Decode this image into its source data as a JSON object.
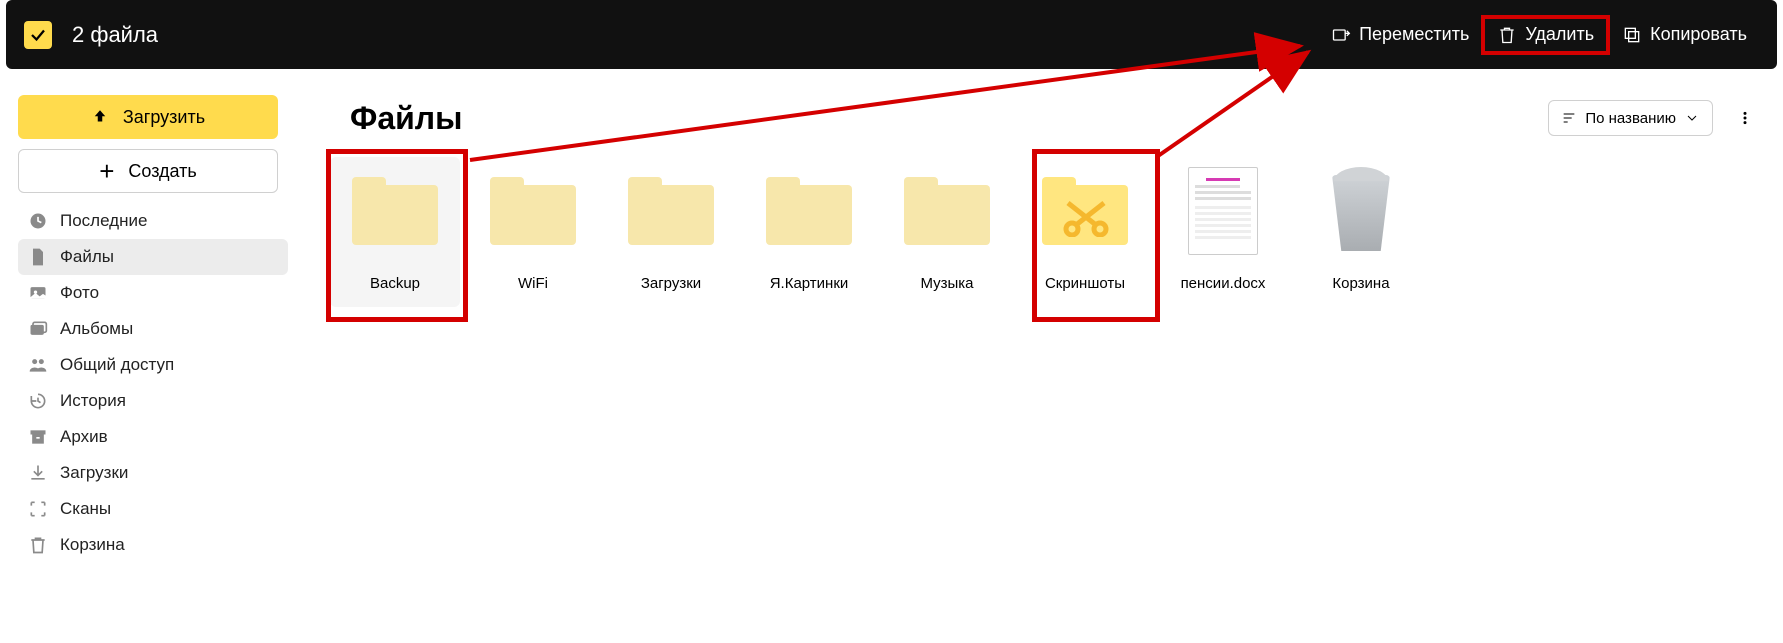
{
  "topbar": {
    "selection_label": "2 файла",
    "move_label": "Переместить",
    "delete_label": "Удалить",
    "copy_label": "Копировать"
  },
  "sidebar": {
    "upload_label": "Загрузить",
    "create_label": "Создать",
    "items": [
      {
        "id": "recent",
        "label": "Последние"
      },
      {
        "id": "files",
        "label": "Файлы"
      },
      {
        "id": "photo",
        "label": "Фото"
      },
      {
        "id": "albums",
        "label": "Альбомы"
      },
      {
        "id": "shared",
        "label": "Общий доступ"
      },
      {
        "id": "history",
        "label": "История"
      },
      {
        "id": "archive",
        "label": "Архив"
      },
      {
        "id": "downloads",
        "label": "Загрузки"
      },
      {
        "id": "scans",
        "label": "Сканы"
      },
      {
        "id": "trash",
        "label": "Корзина"
      }
    ]
  },
  "main": {
    "title": "Файлы",
    "sort_label": "По названию",
    "items": [
      {
        "type": "folder",
        "name": "Backup",
        "selected": true
      },
      {
        "type": "folder",
        "name": "WiFi"
      },
      {
        "type": "folder",
        "name": "Загрузки"
      },
      {
        "type": "folder",
        "name": "Я.Картинки"
      },
      {
        "type": "folder",
        "name": "Музыка"
      },
      {
        "type": "folder-scissors",
        "name": "Скриншоты"
      },
      {
        "type": "doc",
        "name": "пенсии.docx",
        "selected": true
      },
      {
        "type": "trash",
        "name": "Корзина"
      }
    ]
  }
}
